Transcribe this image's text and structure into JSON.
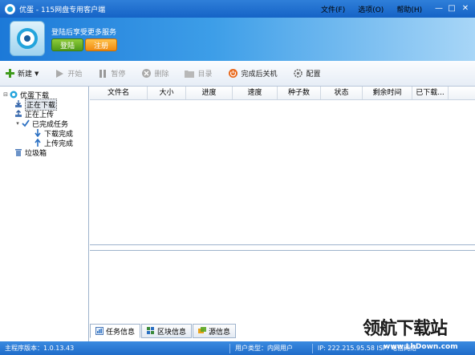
{
  "titlebar": {
    "title": "优蛋 - 115网盘专用客户端",
    "menu": [
      "文件(F)",
      "选项(O)",
      "帮助(H)"
    ],
    "controls": {
      "minimize": "—",
      "maximize": "□",
      "close": "✕"
    }
  },
  "banner": {
    "slogan": "登陆后享受更多服务",
    "login_label": "登陆",
    "register_label": "注册"
  },
  "toolbar": {
    "new": "新建",
    "start": "开始",
    "pause": "暂停",
    "delete": "删除",
    "directory": "目录",
    "shutdown": "完成后关机",
    "config": "配置"
  },
  "tree": {
    "root": "优蛋下载",
    "downloading": "正在下载",
    "uploading": "正在上传",
    "completed": "已完成任务",
    "download_done": "下载完成",
    "upload_done": "上传完成",
    "trash": "垃圾箱"
  },
  "table": {
    "columns": [
      "文件名",
      "大小",
      "进度",
      "速度",
      "种子数",
      "状态",
      "剩余时间",
      "已下载..."
    ]
  },
  "tabs": [
    "任务信息",
    "区块信息",
    "源信息"
  ],
  "statusbar": {
    "version": "主程序版本：1.0.13.43",
    "user_type": "用户类型：内网用户",
    "ip": "IP: 222.215.95.58  ISP: 电信网络"
  },
  "watermark": {
    "text": "领航下载站",
    "url": "www.LhDown.com"
  },
  "colors": {
    "titlebar": "#1f6fcf",
    "accent_green": "#5aa624",
    "accent_orange": "#f39a1a",
    "statusbar": "#2a7bd6"
  },
  "icons": {
    "new": "plus-icon",
    "start": "play-icon",
    "pause": "pause-icon",
    "delete": "delete-icon",
    "directory": "folder-icon",
    "shutdown": "power-icon",
    "config": "gear-icon"
  }
}
